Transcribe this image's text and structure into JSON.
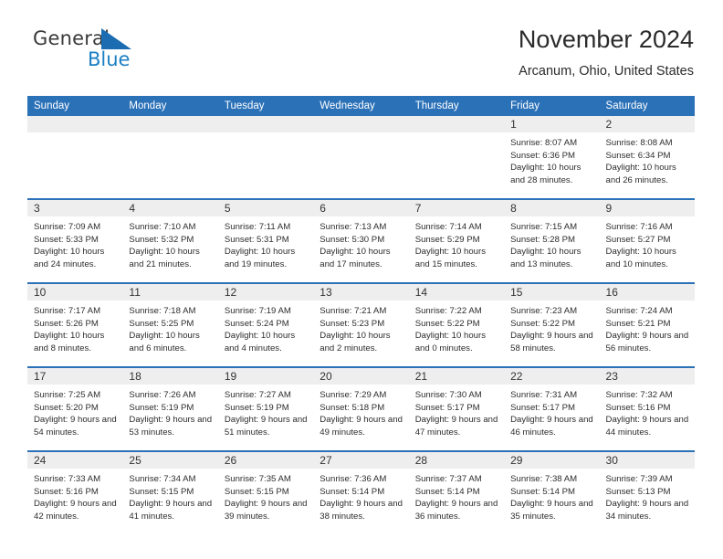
{
  "brand": {
    "name_part1": "General",
    "name_part2": "Blue",
    "flag_color": "#1b7fc4"
  },
  "header": {
    "title": "November 2024",
    "subtitle": "Arcanum, Ohio, United States"
  },
  "theme": {
    "header_blue": "#2b71b8",
    "daynum_gray": "#eeeeee",
    "text": "#2d2d2d"
  },
  "weekday_headers": [
    "Sunday",
    "Monday",
    "Tuesday",
    "Wednesday",
    "Thursday",
    "Friday",
    "Saturday"
  ],
  "labels": {
    "sunrise": "Sunrise:",
    "sunset": "Sunset:",
    "daylight": "Daylight:"
  },
  "weeks": [
    [
      {
        "day": "",
        "empty": true
      },
      {
        "day": "",
        "empty": true
      },
      {
        "day": "",
        "empty": true
      },
      {
        "day": "",
        "empty": true
      },
      {
        "day": "",
        "empty": true
      },
      {
        "day": "1",
        "sunrise": "Sunrise: 8:07 AM",
        "sunset": "Sunset: 6:36 PM",
        "daylight": "Daylight: 10 hours and 28 minutes."
      },
      {
        "day": "2",
        "sunrise": "Sunrise: 8:08 AM",
        "sunset": "Sunset: 6:34 PM",
        "daylight": "Daylight: 10 hours and 26 minutes."
      }
    ],
    [
      {
        "day": "3",
        "sunrise": "Sunrise: 7:09 AM",
        "sunset": "Sunset: 5:33 PM",
        "daylight": "Daylight: 10 hours and 24 minutes."
      },
      {
        "day": "4",
        "sunrise": "Sunrise: 7:10 AM",
        "sunset": "Sunset: 5:32 PM",
        "daylight": "Daylight: 10 hours and 21 minutes."
      },
      {
        "day": "5",
        "sunrise": "Sunrise: 7:11 AM",
        "sunset": "Sunset: 5:31 PM",
        "daylight": "Daylight: 10 hours and 19 minutes."
      },
      {
        "day": "6",
        "sunrise": "Sunrise: 7:13 AM",
        "sunset": "Sunset: 5:30 PM",
        "daylight": "Daylight: 10 hours and 17 minutes."
      },
      {
        "day": "7",
        "sunrise": "Sunrise: 7:14 AM",
        "sunset": "Sunset: 5:29 PM",
        "daylight": "Daylight: 10 hours and 15 minutes."
      },
      {
        "day": "8",
        "sunrise": "Sunrise: 7:15 AM",
        "sunset": "Sunset: 5:28 PM",
        "daylight": "Daylight: 10 hours and 13 minutes."
      },
      {
        "day": "9",
        "sunrise": "Sunrise: 7:16 AM",
        "sunset": "Sunset: 5:27 PM",
        "daylight": "Daylight: 10 hours and 10 minutes."
      }
    ],
    [
      {
        "day": "10",
        "sunrise": "Sunrise: 7:17 AM",
        "sunset": "Sunset: 5:26 PM",
        "daylight": "Daylight: 10 hours and 8 minutes."
      },
      {
        "day": "11",
        "sunrise": "Sunrise: 7:18 AM",
        "sunset": "Sunset: 5:25 PM",
        "daylight": "Daylight: 10 hours and 6 minutes."
      },
      {
        "day": "12",
        "sunrise": "Sunrise: 7:19 AM",
        "sunset": "Sunset: 5:24 PM",
        "daylight": "Daylight: 10 hours and 4 minutes."
      },
      {
        "day": "13",
        "sunrise": "Sunrise: 7:21 AM",
        "sunset": "Sunset: 5:23 PM",
        "daylight": "Daylight: 10 hours and 2 minutes."
      },
      {
        "day": "14",
        "sunrise": "Sunrise: 7:22 AM",
        "sunset": "Sunset: 5:22 PM",
        "daylight": "Daylight: 10 hours and 0 minutes."
      },
      {
        "day": "15",
        "sunrise": "Sunrise: 7:23 AM",
        "sunset": "Sunset: 5:22 PM",
        "daylight": "Daylight: 9 hours and 58 minutes."
      },
      {
        "day": "16",
        "sunrise": "Sunrise: 7:24 AM",
        "sunset": "Sunset: 5:21 PM",
        "daylight": "Daylight: 9 hours and 56 minutes."
      }
    ],
    [
      {
        "day": "17",
        "sunrise": "Sunrise: 7:25 AM",
        "sunset": "Sunset: 5:20 PM",
        "daylight": "Daylight: 9 hours and 54 minutes."
      },
      {
        "day": "18",
        "sunrise": "Sunrise: 7:26 AM",
        "sunset": "Sunset: 5:19 PM",
        "daylight": "Daylight: 9 hours and 53 minutes."
      },
      {
        "day": "19",
        "sunrise": "Sunrise: 7:27 AM",
        "sunset": "Sunset: 5:19 PM",
        "daylight": "Daylight: 9 hours and 51 minutes."
      },
      {
        "day": "20",
        "sunrise": "Sunrise: 7:29 AM",
        "sunset": "Sunset: 5:18 PM",
        "daylight": "Daylight: 9 hours and 49 minutes."
      },
      {
        "day": "21",
        "sunrise": "Sunrise: 7:30 AM",
        "sunset": "Sunset: 5:17 PM",
        "daylight": "Daylight: 9 hours and 47 minutes."
      },
      {
        "day": "22",
        "sunrise": "Sunrise: 7:31 AM",
        "sunset": "Sunset: 5:17 PM",
        "daylight": "Daylight: 9 hours and 46 minutes."
      },
      {
        "day": "23",
        "sunrise": "Sunrise: 7:32 AM",
        "sunset": "Sunset: 5:16 PM",
        "daylight": "Daylight: 9 hours and 44 minutes."
      }
    ],
    [
      {
        "day": "24",
        "sunrise": "Sunrise: 7:33 AM",
        "sunset": "Sunset: 5:16 PM",
        "daylight": "Daylight: 9 hours and 42 minutes."
      },
      {
        "day": "25",
        "sunrise": "Sunrise: 7:34 AM",
        "sunset": "Sunset: 5:15 PM",
        "daylight": "Daylight: 9 hours and 41 minutes."
      },
      {
        "day": "26",
        "sunrise": "Sunrise: 7:35 AM",
        "sunset": "Sunset: 5:15 PM",
        "daylight": "Daylight: 9 hours and 39 minutes."
      },
      {
        "day": "27",
        "sunrise": "Sunrise: 7:36 AM",
        "sunset": "Sunset: 5:14 PM",
        "daylight": "Daylight: 9 hours and 38 minutes."
      },
      {
        "day": "28",
        "sunrise": "Sunrise: 7:37 AM",
        "sunset": "Sunset: 5:14 PM",
        "daylight": "Daylight: 9 hours and 36 minutes."
      },
      {
        "day": "29",
        "sunrise": "Sunrise: 7:38 AM",
        "sunset": "Sunset: 5:14 PM",
        "daylight": "Daylight: 9 hours and 35 minutes."
      },
      {
        "day": "30",
        "sunrise": "Sunrise: 7:39 AM",
        "sunset": "Sunset: 5:13 PM",
        "daylight": "Daylight: 9 hours and 34 minutes."
      }
    ]
  ]
}
